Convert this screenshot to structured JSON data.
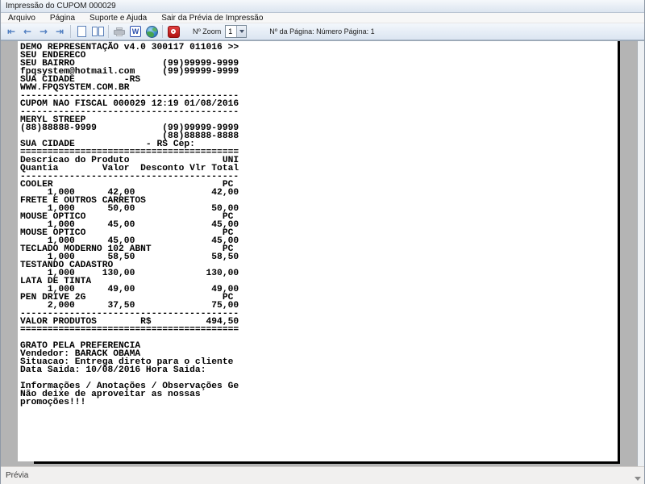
{
  "window": {
    "title": "Impressão do CUPOM 000029"
  },
  "menu": {
    "items": [
      "Arquivo",
      "Página",
      "Suporte e Ajuda",
      "Sair da Prévia de Impressão"
    ]
  },
  "toolbar": {
    "first_icon": "⇤",
    "prev_icon": "←",
    "next_icon": "→",
    "last_icon": "⇥",
    "word_letter": "W",
    "zoom_label": "Nº Zoom",
    "zoom_value": "1",
    "page_info": "Nº da Página: Número Página: 1"
  },
  "receipt": {
    "text": "DEMO REPRESENTAÇÃO v4.0 300117 011016 >>\nSEU ENDERECO\nSEU BAIRRO                (99)99999-9999\nfpqsystem@hotmail.com     (99)99999-9999\nSUA CIDADE         -RS\nWWW.FPQSYSTEM.COM.BR\n----------------------------------------\nCUPOM NAO FISCAL 000029 12:19 01/08/2016\n----------------------------------------\nMERYL STREEP\n(88)88888-9999            (99)99999-9999\n                          (88)88888-8888\nSUA CIDADE             - RS Cep:\n========================================\nDescricao do Produto                 UNI\nQuantia        Valor  Desconto Vlr Total\n----------------------------------------\nCOOLER                               PC\n     1,000      42,00              42,00\nFRETE E OUTROS CARRETOS\n     1,000      50,00              50,00\nMOUSE OPTICO                         PC\n     1,000      45,00              45,00\nMOUSE OPTICO                         PC\n     1,000      45,00              45,00\nTECLADO MODERNO 102 ABNT             PC\n     1,000      58,50              58,50\nTESTANDO CADASTRO\n     1,000     130,00             130,00\nLATA DE TINTA\n     1,000      49,00              49,00\nPEN DRIVE 2G                         PC\n     2,000      37,50              75,00\n----------------------------------------\nVALOR PRODUTOS        R$          494,50\n========================================\n\nGRATO PELA PREFERENCIA\nVendedor: BARACK OBAMA\nSituacao: Entrega direto para o cliente\nData Saida: 10/08/2016 Hora Saida:\n\nInformações / Anotações / Observações Ge\nNão deixe de aproveitar as nossas\npromoções!!!"
  },
  "statusbar": {
    "text": "Prévia"
  },
  "colors": {
    "toolbar_icon_blue": "#4f7dc0",
    "word_icon_blue": "#2b4fae",
    "red_icon": "#b01212",
    "content_bg": "#b4b4b4"
  }
}
